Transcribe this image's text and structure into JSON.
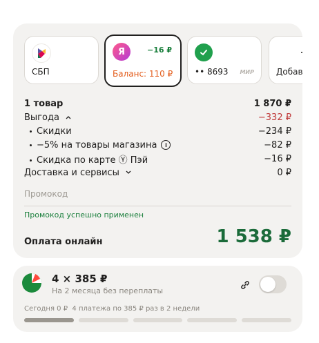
{
  "payment_methods": [
    {
      "id": "sbp",
      "label": "СБП",
      "icon": "sbp-logo-icon"
    },
    {
      "id": "yandex",
      "label": "Баланс: 110 ₽",
      "sub": "−16 ₽",
      "icon": "yandex-pay-icon",
      "selected": true
    },
    {
      "id": "card",
      "label": "•• 8693",
      "badge": "МИР",
      "icon": "green-check-card-icon"
    },
    {
      "id": "add",
      "label": "Добавить",
      "icon": "add-icon"
    }
  ],
  "summary": {
    "items_label": "1 товар",
    "items_value": "1 870 ₽",
    "benefit_label": "Выгода",
    "benefit_value": "−332 ₽",
    "discounts_label": "Скидки",
    "discounts_value": "−234 ₽",
    "store_label": "−5% на товары магазина",
    "store_value": "−82 ₽",
    "card_label": "Скидка по карте Ⓨ Пэй",
    "card_value": "−16 ₽",
    "delivery_label": "Доставка и сервисы",
    "delivery_value": "0 ₽"
  },
  "promo": {
    "placeholder": "Промокод",
    "success": "Промокод успешно применен"
  },
  "total": {
    "label": "Оплата онлайн",
    "amount": "1 538 ₽"
  },
  "split": {
    "title": "4 × 385 ₽",
    "subtitle": "На 2 месяца без переплаты",
    "schedule_today": "Сегодня 0 ₽",
    "schedule_rest": "4 платежа по 385 ₽ раз в 2 недели",
    "toggle_on": false,
    "payments_done": 1,
    "payments_total": 5
  },
  "colors": {
    "accent_green": "#1b6b3a",
    "negative": "#c03b3b",
    "yandex_orange": "#e35d1c"
  }
}
